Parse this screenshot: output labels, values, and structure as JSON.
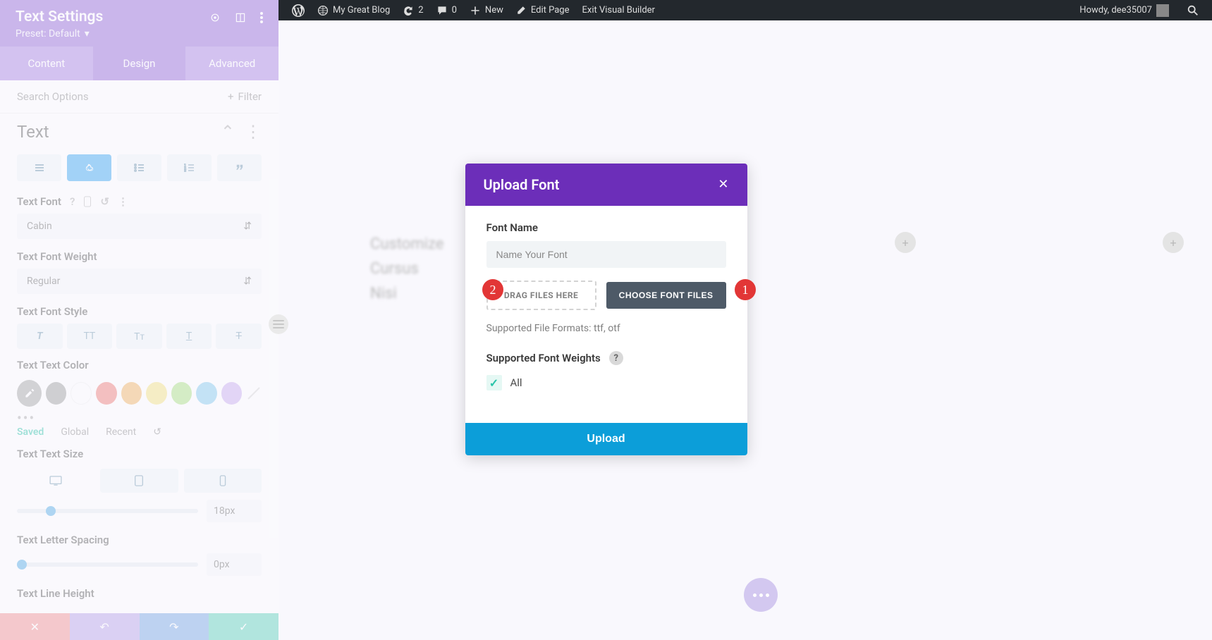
{
  "adminBar": {
    "siteName": "My Great Blog",
    "refreshCount": "2",
    "commentCount": "0",
    "newLabel": "New",
    "editPage": "Edit Page",
    "exitBuilder": "Exit Visual Builder",
    "greeting": "Howdy, dee35007"
  },
  "sidebar": {
    "title": "Text Settings",
    "preset": "Preset: Default",
    "tabs": [
      "Content",
      "Design",
      "Advanced"
    ],
    "searchPlaceholder": "Search Options",
    "filterLabel": "Filter",
    "sectionTitle": "Text",
    "props": {
      "font": {
        "label": "Text Font",
        "value": "Cabin"
      },
      "weight": {
        "label": "Text Font Weight",
        "value": "Regular"
      },
      "style": {
        "label": "Text Font Style"
      },
      "color": {
        "label": "Text Text Color"
      },
      "size": {
        "label": "Text Text Size",
        "value": "18px"
      },
      "spacing": {
        "label": "Text Letter Spacing",
        "value": "0px"
      },
      "lineHeight": {
        "label": "Text Line Height"
      }
    },
    "recentTabs": {
      "saved": "Saved",
      "global": "Global",
      "recent": "Recent"
    }
  },
  "modal": {
    "title": "Upload Font",
    "fontNameLabel": "Font Name",
    "fontNamePlaceholder": "Name Your Font",
    "dragLabel": "DRAG FILES HERE",
    "chooseLabel": "CHOOSE FONT FILES",
    "supportedFormats": "Supported File Formats: ttf, otf",
    "supportedWeights": "Supported Font Weights",
    "allLabel": "All",
    "uploadLabel": "Upload"
  },
  "callouts": {
    "one": "1",
    "two": "2"
  },
  "blurText": {
    "l1": "Customize",
    "l2": "Cursus",
    "l3": "Nisi"
  }
}
